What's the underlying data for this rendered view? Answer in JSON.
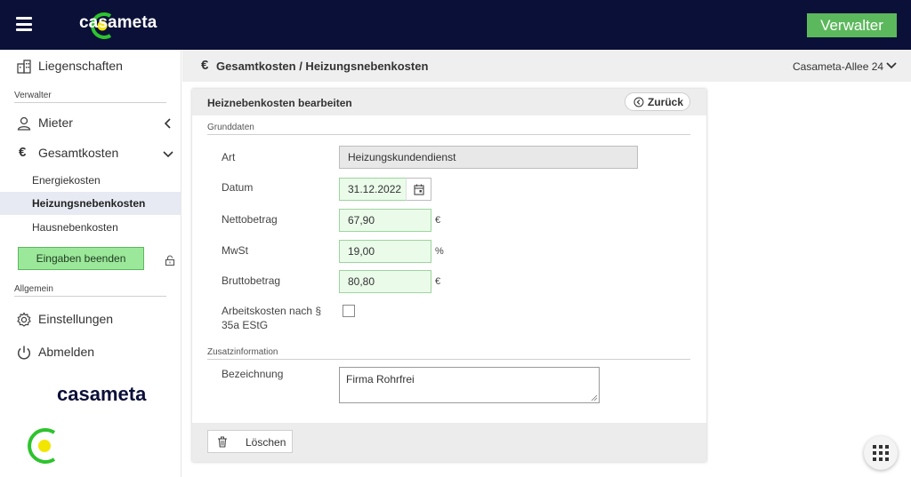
{
  "topbar": {
    "logo_text": "casameta",
    "role_label": "Verwalter"
  },
  "sidebar": {
    "properties_label": "Liegenschaften",
    "section_manager": "Verwalter",
    "tenants_label": "Mieter",
    "total_costs_label": "Gesamtkosten",
    "sub_items": [
      {
        "label": "Energiekosten"
      },
      {
        "label": "Heizungsnebenkosten"
      },
      {
        "label": "Hausnebenkosten"
      }
    ],
    "end_input_label": "Eingaben beenden",
    "section_general": "Allgemein",
    "settings_label": "Einstellungen",
    "logout_label": "Abmelden",
    "bottom_logo_text": "casameta"
  },
  "header": {
    "breadcrumb": "Gesamtkosten / Heizungsnebenkosten",
    "address": "Casameta-Allee 24"
  },
  "card": {
    "title": "Heiznebenkosten bearbeiten",
    "back_label": "Zurück",
    "group_basic": "Grunddaten",
    "group_extra": "Zusatzinformation",
    "fields": {
      "type_label": "Art",
      "type_value": "Heizungskundendienst",
      "date_label": "Datum",
      "date_value": "31.12.2022",
      "net_label": "Nettobetrag",
      "net_value": "67,90",
      "net_unit": "€",
      "vat_label": "MwSt",
      "vat_value": "19,00",
      "vat_unit": "%",
      "gross_label": "Bruttobetrag",
      "gross_value": "80,80",
      "gross_unit": "€",
      "labor_label": "Arbeitskosten nach § 35a EStG",
      "labor_checked": false,
      "designation_label": "Bezeichnung",
      "designation_value": "Firma Rohrfrei"
    },
    "delete_label": "Löschen"
  },
  "colors": {
    "topbar_bg": "#0b1038",
    "brand_green": "#5cb85c",
    "logo_yellow": "#f2e600",
    "logo_green": "#2ec32e"
  }
}
